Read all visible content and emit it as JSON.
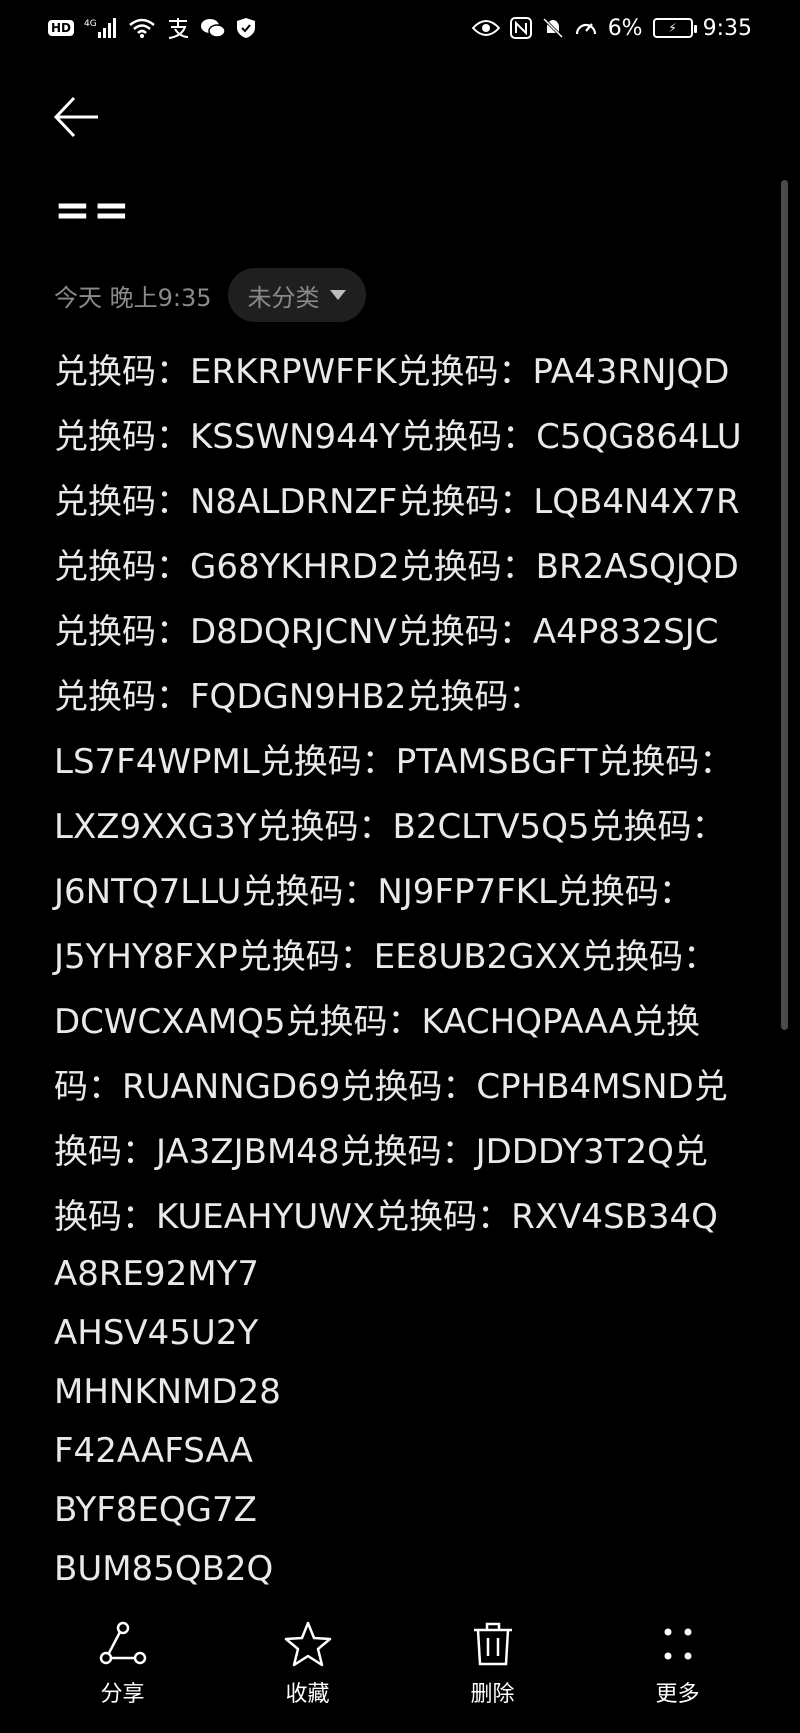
{
  "status_bar": {
    "hd": "HD",
    "network": "4G",
    "battery_pct": "6%",
    "time": "9:35"
  },
  "note": {
    "title": "==",
    "time": "今天 晚上9:35",
    "category": "未分类",
    "lines": [
      "兑换码：ERKRPWFFK兑换码：PA43RNJQD",
      "兑换码：KSSWN944Y兑换码：C5QG864LU",
      "兑换码：N8ALDRNZF兑换码：LQB4N4X7R",
      "兑换码：G68YKHRD2兑换码：BR2ASQJQD",
      "兑换码：D8DQRJCNV兑换码：A4P832SJC",
      "兑换码：FQDGN9HB2兑换码：",
      "LS7F4WPML兑换码：PTAMSBGFT兑换码：",
      "LXZ9XXG3Y兑换码：B2CLTV5Q5兑换码：",
      "J6NTQ7LLU兑换码：NJ9FP7FKL兑换码：",
      "J5YHY8FXP兑换码：EE8UB2GXX兑换码：",
      "DCWCXAMQ5兑换码：KACHQPAAA兑换",
      "码：RUANNGD69兑换码：CPHB4MSND兑",
      "换码：JA3ZJBM48兑换码：JDDDY3T2Q兑",
      "换码：KUEAHYUWX兑换码：RXV4SB34Q"
    ],
    "codes": [
      "A8RE92MY7",
      "AHSV45U2Y",
      "MHNKNMD28",
      "F42AAFSAA",
      "BYF8EQG7Z",
      "BUM85QB2Q"
    ]
  },
  "actions": {
    "share": "分享",
    "favorite": "收藏",
    "delete": "删除",
    "more": "更多"
  },
  "icons": [
    "back-arrow-icon",
    "share-icon",
    "star-icon",
    "trash-icon",
    "more-dots-icon"
  ]
}
